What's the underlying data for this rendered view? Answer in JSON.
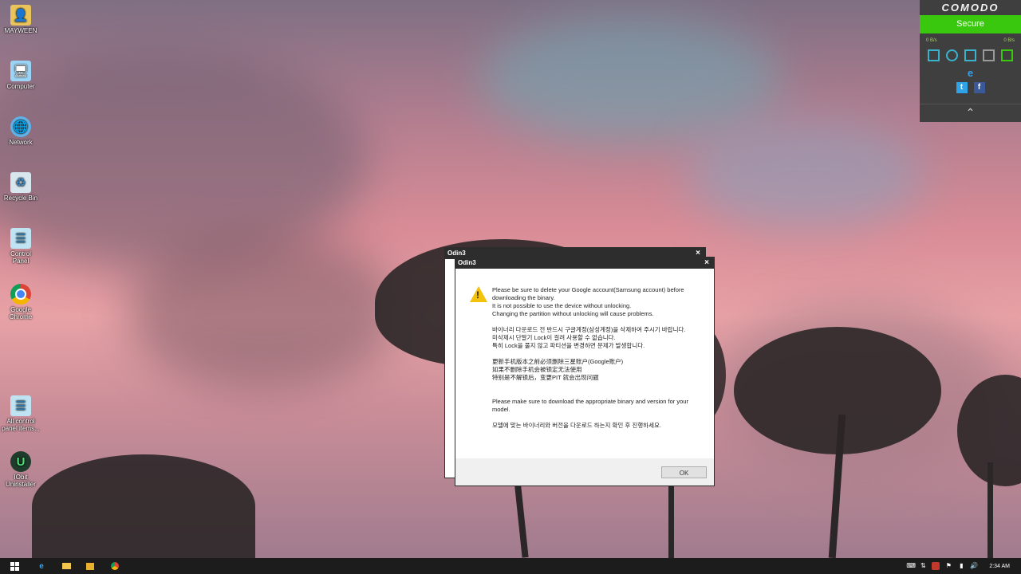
{
  "desktop": {
    "icons": [
      {
        "label": "MAYWEEN",
        "icon": "user-folder-icon"
      },
      {
        "label": "Computer",
        "icon": "computer-icon"
      },
      {
        "label": "Network",
        "icon": "network-icon"
      },
      {
        "label": "Recycle Bin",
        "icon": "recycle-bin-icon"
      },
      {
        "label": "Control Panel",
        "icon": "control-panel-icon"
      },
      {
        "label": "Google Chrome",
        "icon": "chrome-icon"
      },
      {
        "label": "All control panel items...",
        "icon": "control-panel-icon"
      },
      {
        "label": "IObit Uninstaller",
        "icon": "iobit-uninstaller-icon"
      }
    ]
  },
  "comodo": {
    "brand": "COMODO",
    "status": "Secure",
    "status_color": "#39c80d",
    "rate_in": "0 B/s",
    "rate_out": "0 B/s",
    "tools": [
      "layout-icon",
      "refresh-icon",
      "window-icon",
      "camera-icon",
      "network-monitor-icon"
    ],
    "social": [
      "internet-explorer-icon",
      "twitter-icon",
      "facebook-icon"
    ],
    "collapse_icon": "chevron-up-icon"
  },
  "dialog_back": {
    "title": "Odin3",
    "close": "×"
  },
  "dialog": {
    "title": "Odin3",
    "close": "×",
    "icon": "warning-icon",
    "en_1": "Please be sure to delete your Google account(Samsung account) before downloading the binary.",
    "en_2": "It is not possible to use the device without unlocking.",
    "en_3": "Changing the partition without unlocking will cause problems.",
    "ko_1": "바이너리 다운로드 전 반드시 구글계정(삼성계정)을 삭제하여 주시기 바랍니다.",
    "ko_2": "미삭제시 단말기 Lock이 걸려 사용할 수 없습니다.",
    "ko_3": "특히 Lock을 풀지 않고 파티션을 변경하면 문제가 발생합니다.",
    "zh_1": "更新手机版本之前必须删除三星账户(Google账户)",
    "zh_2": "如果不删除手机会被锁定无法使用",
    "zh_3": "特别是不解锁后，变更PIT 就会出现问题",
    "en_4": "Please make sure to download the appropriate binary and version for your model.",
    "ko_4": "모델에 맞는 바이너리와 버전을 다운로드 하는지 확인 후 진행하세요.",
    "ok": "OK"
  },
  "taskbar": {
    "start_icon": "windows-start-icon",
    "pinned": [
      "internet-explorer-icon",
      "file-explorer-icon",
      "media-player-icon",
      "chrome-icon"
    ],
    "tray": [
      "keyboard-icon",
      "network-status-icon",
      "comodo-tray-icon",
      "flag-icon",
      "battery-icon",
      "volume-icon"
    ],
    "clock": "2:34 AM"
  }
}
